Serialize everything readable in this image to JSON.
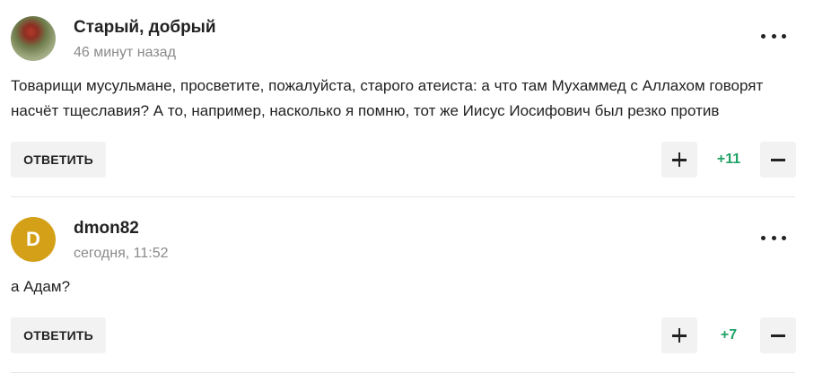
{
  "comments": [
    {
      "author": "Старый, добрый",
      "time": "46 минут назад",
      "avatar_letter": "",
      "text": "Товарищи мусульмане, просветите, пожалуйста, старого атеиста: а что там Мухаммед с Аллахом говорят насчёт тщеславия? А то, например, насколько я помню, тот же Иисус Иосифович был резко против",
      "reply_label": "ОТВЕТИТЬ",
      "score": "+11"
    },
    {
      "author": "dmon82",
      "time": "сегодня, 11:52",
      "avatar_letter": "D",
      "text": "а Адам?",
      "reply_label": "ОТВЕТИТЬ",
      "score": "+7"
    }
  ],
  "icons": {
    "more": "more-dots-icon",
    "upvote": "plus-icon",
    "downvote": "minus-icon"
  },
  "colors": {
    "score_positive": "#21a366",
    "button_bg": "#f2f2f2",
    "avatar_letter_bg": "#d4a017",
    "meta_text": "#8a8a8a"
  }
}
